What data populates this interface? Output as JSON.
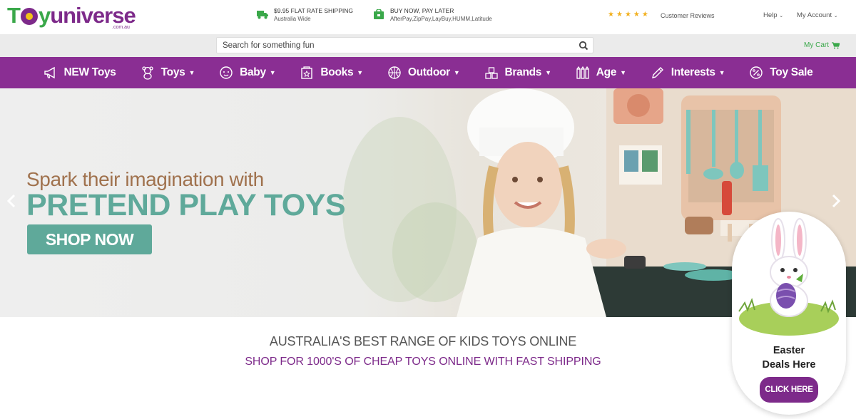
{
  "header": {
    "logo": {
      "brand_part1": "Toy",
      "brand_part2": "universe",
      "suffix": ".com.au"
    },
    "usps": [
      {
        "title": "$9.95 FLAT RATE SHIPPING",
        "subtitle": "Australia Wide",
        "icon": "truck-icon"
      },
      {
        "title": "BUY NOW, PAY LATER",
        "subtitle": "AfterPay,ZipPay,LayBuy,HUMM,Latitude",
        "icon": "shopping-bag-icon"
      }
    ],
    "reviews": {
      "rating": 5,
      "label": "Customer Reviews"
    },
    "help": "Help",
    "account": "My Account"
  },
  "search": {
    "placeholder": "Search for something fun"
  },
  "cart": {
    "label": "My Cart"
  },
  "nav": {
    "items": [
      {
        "label": "NEW Toys",
        "icon": "megaphone-icon",
        "dropdown": false
      },
      {
        "label": "Toys",
        "icon": "teddy-bear-icon",
        "dropdown": true
      },
      {
        "label": "Baby",
        "icon": "baby-face-icon",
        "dropdown": true
      },
      {
        "label": "Books",
        "icon": "book-icon",
        "dropdown": true
      },
      {
        "label": "Outdoor",
        "icon": "ball-icon",
        "dropdown": true
      },
      {
        "label": "Brands",
        "icon": "blocks-icon",
        "dropdown": true
      },
      {
        "label": "Age",
        "icon": "crayons-icon",
        "dropdown": true
      },
      {
        "label": "Interests",
        "icon": "pencil-icon",
        "dropdown": true
      },
      {
        "label": "Toy Sale",
        "icon": "percent-badge-icon",
        "dropdown": false
      }
    ]
  },
  "hero": {
    "line1": "Spark their imagination with",
    "line2": "PRETEND PLAY TOYS",
    "cta": "SHOP NOW"
  },
  "taglines": {
    "line1": "AUSTRALIA'S BEST RANGE OF KIDS TOYS ONLINE",
    "line2": "SHOP FOR 1000'S OF CHEAP TOYS ONLINE WITH FAST SHIPPING"
  },
  "easter": {
    "title_line1": "Easter",
    "title_line2": "Deals Here",
    "cta": "CLICK HERE"
  },
  "colors": {
    "brand_purple": "#8a2e93",
    "brand_green": "#3aa84a",
    "hero_teal": "#5fa99a",
    "hero_brown": "#a0724e",
    "star_gold": "#f2b01e"
  }
}
